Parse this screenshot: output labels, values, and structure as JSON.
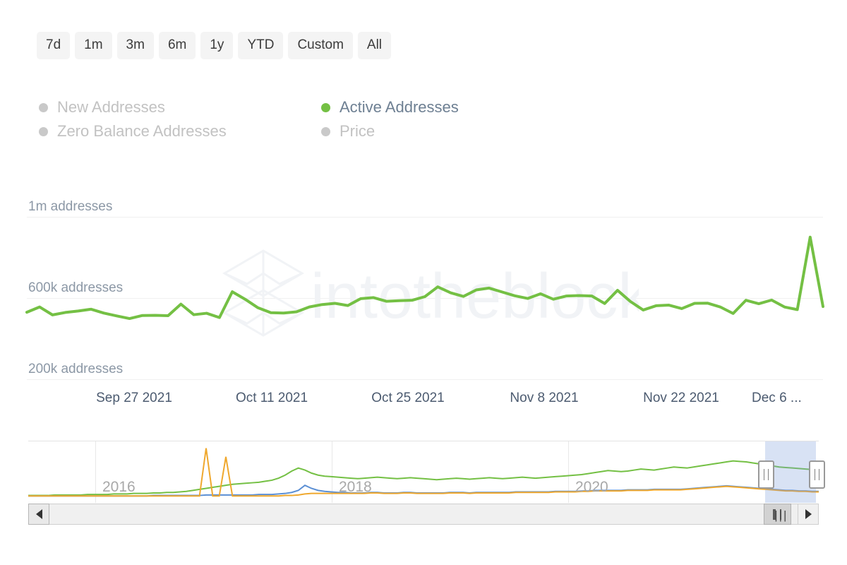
{
  "range_selector": {
    "buttons": [
      {
        "label": "7d",
        "selected": false
      },
      {
        "label": "1m",
        "selected": false
      },
      {
        "label": "3m",
        "selected": false
      },
      {
        "label": "6m",
        "selected": false
      },
      {
        "label": "1y",
        "selected": false
      },
      {
        "label": "YTD",
        "selected": false
      },
      {
        "label": "Custom",
        "selected": false
      },
      {
        "label": "All",
        "selected": false
      }
    ]
  },
  "legend": {
    "items": [
      {
        "label": "New Addresses",
        "color": "#c9c9c9",
        "active": false
      },
      {
        "label": "Active Addresses",
        "color": "#74c044",
        "active": true
      },
      {
        "label": "Zero Balance Addresses",
        "color": "#c9c9c9",
        "active": false
      },
      {
        "label": "Price",
        "color": "#c9c9c9",
        "active": false
      }
    ]
  },
  "watermark": {
    "text": "intotheblock",
    "logo_icon": "hexagon-cube-logo",
    "color": "#f1f3f6"
  },
  "navigator": {
    "year_labels": [
      "2016",
      "2018",
      "2020"
    ],
    "series_colors": {
      "active": "#74c044",
      "new": "#5b8fd4",
      "zero_balance": "#efa82e"
    },
    "selection": {
      "start_pct": 93.2,
      "end_pct": 99.6
    },
    "handle_icon": "drag-handle-icon"
  },
  "scrollbar": {
    "left_arrow_icon": "arrow-left-icon",
    "right_arrow_icon": "arrow-right-icon",
    "thumb_grip": "|||",
    "thumb_start_pct": 93.0,
    "thumb_end_pct": 96.5
  },
  "chart_data": {
    "type": "line",
    "title": "",
    "xlabel": "",
    "ylabel": "addresses",
    "grid": true,
    "legend_position": "top-left",
    "ylim": [
      200000,
      1000000
    ],
    "ytick_labels": [
      "1m addresses",
      "600k addresses",
      "200k addresses"
    ],
    "ytick_values": [
      1000000,
      600000,
      200000
    ],
    "xtick_labels": [
      "Sep 27 2021",
      "Oct 11 2021",
      "Oct 25 2021",
      "Nov 8 2021",
      "Nov 22 2021",
      "Dec 6 ..."
    ],
    "series": [
      {
        "name": "Active Addresses",
        "color": "#74c044",
        "values": [
          530000,
          556000,
          517000,
          529000,
          536000,
          545000,
          526000,
          512000,
          499000,
          514000,
          515000,
          513000,
          570000,
          518000,
          525000,
          504000,
          631000,
          594000,
          552000,
          528000,
          526000,
          532000,
          556000,
          568000,
          574000,
          563000,
          597000,
          602000,
          584000,
          587000,
          589000,
          607000,
          655000,
          626000,
          608000,
          640000,
          649000,
          630000,
          611000,
          598000,
          621000,
          594000,
          610000,
          612000,
          610000,
          573000,
          638000,
          583000,
          541000,
          562000,
          565000,
          548000,
          574000,
          575000,
          556000,
          524000,
          589000,
          572000,
          590000,
          556000,
          543000,
          900000,
          558000
        ]
      },
      {
        "name": "New Addresses",
        "color": "#5b8fd4",
        "values": []
      },
      {
        "name": "Zero Balance Addresses",
        "color": "#efa82e",
        "values": []
      },
      {
        "name": "Price",
        "color": "#c9c9c9",
        "values": []
      }
    ],
    "navigator_series": [
      {
        "name": "Active Addresses",
        "color": "#74c044",
        "values": [
          2,
          2,
          2,
          2,
          3,
          3,
          3,
          3,
          3,
          4,
          4,
          4,
          4,
          5,
          5,
          5,
          6,
          6,
          6,
          7,
          7,
          8,
          8,
          9,
          10,
          12,
          14,
          16,
          18,
          20,
          22,
          24,
          25,
          26,
          27,
          28,
          30,
          32,
          36,
          42,
          50,
          56,
          52,
          46,
          42,
          40,
          39,
          38,
          37,
          36,
          35,
          36,
          37,
          38,
          37,
          36,
          35,
          36,
          37,
          36,
          35,
          34,
          33,
          34,
          35,
          36,
          35,
          34,
          35,
          36,
          37,
          36,
          35,
          36,
          37,
          38,
          37,
          36,
          37,
          38,
          39,
          40,
          41,
          42,
          43,
          45,
          47,
          49,
          51,
          50,
          49,
          50,
          52,
          54,
          53,
          52,
          54,
          56,
          58,
          57,
          56,
          58,
          60,
          62,
          64,
          66,
          68,
          70,
          69,
          68,
          66,
          64,
          62,
          60,
          58,
          57,
          56,
          55,
          54,
          53,
          52
        ]
      },
      {
        "name": "New Addresses",
        "color": "#5b8fd4",
        "values": [
          1,
          1,
          1,
          1,
          1,
          1,
          1,
          1,
          1,
          1,
          1,
          1,
          1,
          1,
          1,
          1,
          1,
          1,
          1,
          2,
          2,
          2,
          2,
          2,
          2,
          2,
          2,
          3,
          3,
          3,
          3,
          3,
          3,
          3,
          3,
          4,
          4,
          4,
          5,
          6,
          8,
          12,
          22,
          16,
          12,
          10,
          9,
          8,
          8,
          7,
          7,
          7,
          8,
          8,
          7,
          7,
          7,
          8,
          8,
          7,
          7,
          7,
          7,
          7,
          8,
          8,
          8,
          7,
          8,
          8,
          8,
          8,
          8,
          8,
          9,
          9,
          9,
          9,
          9,
          9,
          10,
          10,
          10,
          10,
          11,
          11,
          12,
          12,
          12,
          12,
          12,
          13,
          13,
          13,
          13,
          14,
          14,
          14,
          14,
          14,
          15,
          16,
          17,
          18,
          19,
          20,
          21,
          20,
          19,
          18,
          17,
          16,
          15,
          14,
          13,
          12,
          12,
          11,
          11,
          10,
          10
        ]
      },
      {
        "name": "Zero Balance Addresses",
        "color": "#efa82e",
        "values": [
          1,
          1,
          1,
          1,
          1,
          1,
          1,
          1,
          1,
          1,
          1,
          1,
          1,
          1,
          1,
          1,
          1,
          1,
          1,
          1,
          1,
          1,
          1,
          1,
          1,
          1,
          1,
          95,
          1,
          1,
          78,
          1,
          1,
          1,
          1,
          1,
          1,
          1,
          1,
          2,
          2,
          3,
          5,
          6,
          6,
          6,
          6,
          6,
          6,
          6,
          6,
          6,
          7,
          7,
          6,
          6,
          6,
          7,
          7,
          6,
          6,
          6,
          6,
          6,
          7,
          7,
          7,
          6,
          7,
          7,
          7,
          7,
          7,
          7,
          8,
          8,
          8,
          8,
          8,
          8,
          9,
          9,
          9,
          9,
          10,
          10,
          11,
          11,
          11,
          11,
          11,
          12,
          12,
          12,
          12,
          13,
          13,
          13,
          13,
          13,
          14,
          15,
          16,
          17,
          18,
          19,
          20,
          19,
          18,
          17,
          16,
          15,
          14,
          13,
          12,
          11,
          11,
          10,
          10,
          9,
          9
        ]
      }
    ]
  }
}
